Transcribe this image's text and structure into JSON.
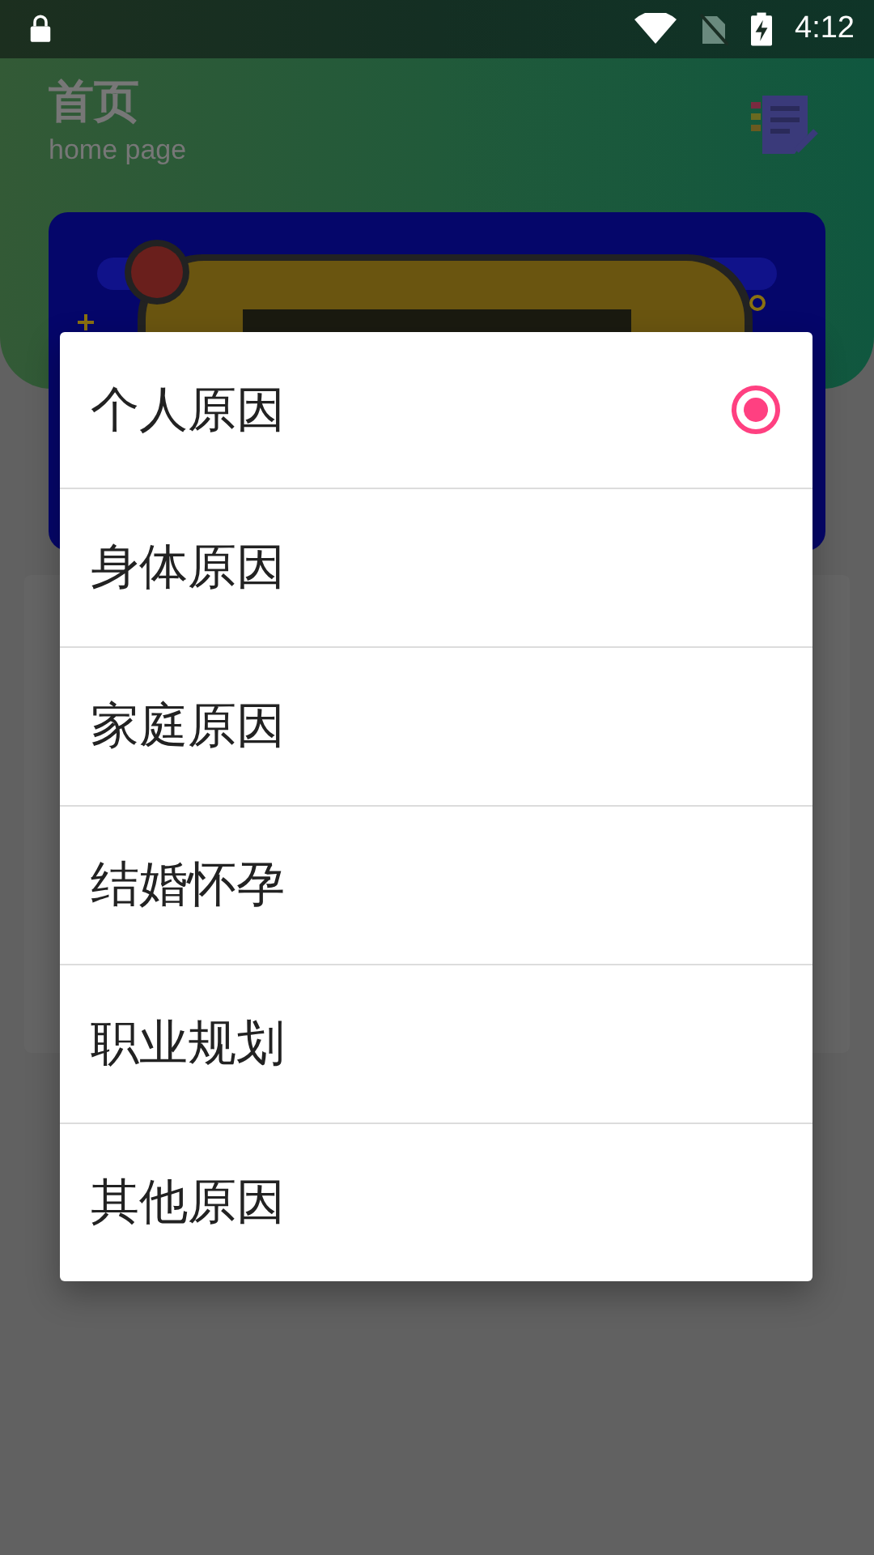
{
  "status_bar": {
    "time": "4:12"
  },
  "header": {
    "title": "首页",
    "subtitle": "home page"
  },
  "dialog": {
    "options": [
      {
        "label": "个人原因",
        "selected": true
      },
      {
        "label": "身体原因",
        "selected": false
      },
      {
        "label": "家庭原因",
        "selected": false
      },
      {
        "label": "结婚怀孕",
        "selected": false
      },
      {
        "label": "职业规划",
        "selected": false
      },
      {
        "label": "其他原因",
        "selected": false
      }
    ]
  }
}
